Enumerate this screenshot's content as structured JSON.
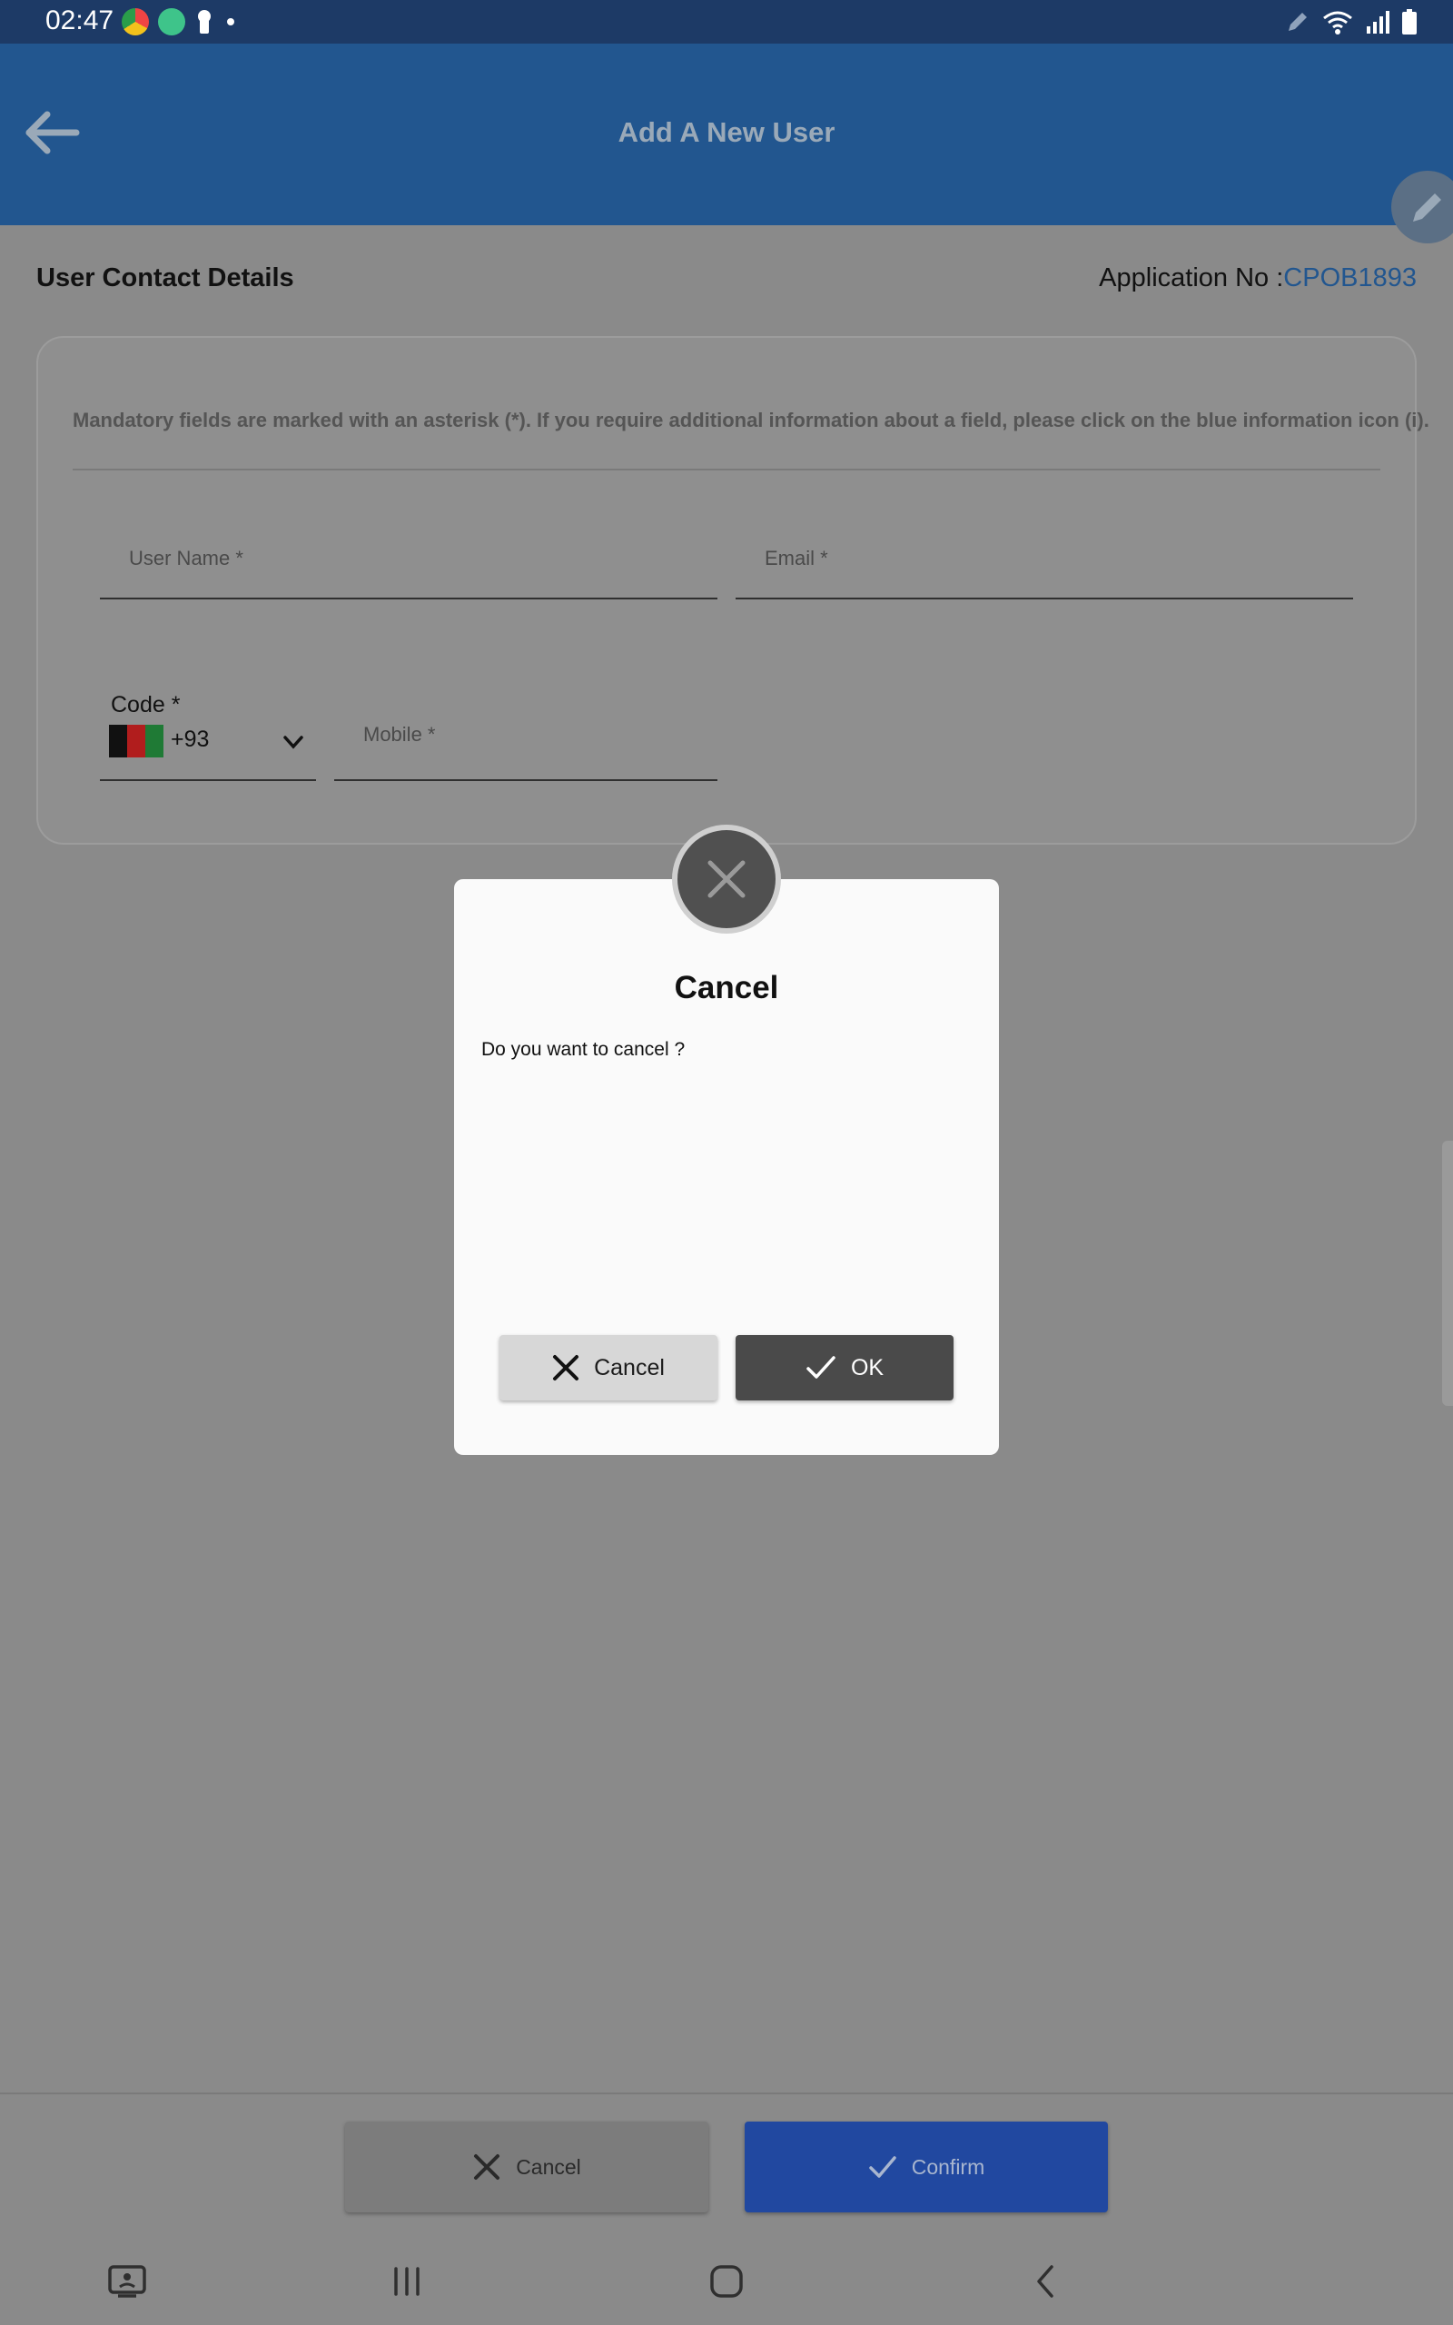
{
  "status_bar": {
    "time": "02:47",
    "left_icons": [
      "chrome-icon",
      "android-icon",
      "keyhole-icon",
      "dot-icon"
    ],
    "right_icons": [
      "pen-icon",
      "wifi-icon",
      "signal-icon",
      "battery-icon"
    ]
  },
  "app_bar": {
    "title": "Add A New User",
    "color": "#22568f"
  },
  "section": {
    "title": "User Contact Details",
    "application_no_label": "Application No :",
    "application_no_value": "CPOB1893"
  },
  "form": {
    "info_text": "Mandatory fields are marked with an asterisk (*). If you require additional information about a field, please click on the blue information icon (i).",
    "user_name_label": "User Name *",
    "email_label": "Email *",
    "code_label": "Code *",
    "code_value": "+93",
    "mobile_label": "Mobile *"
  },
  "dialog": {
    "title": "Cancel",
    "message": "Do you want to cancel ?",
    "cancel_label": "Cancel",
    "ok_label": "OK"
  },
  "bottom_bar": {
    "cancel_label": "Cancel",
    "confirm_label": "Confirm",
    "confirm_color": "#2148a0"
  },
  "nav_bar": {
    "icons": [
      "screenshot-icon",
      "recents-icon",
      "home-icon",
      "back-icon"
    ]
  }
}
